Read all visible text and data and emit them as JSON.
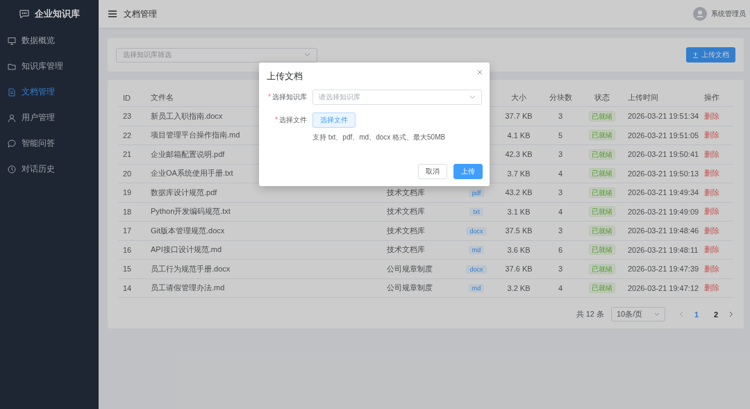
{
  "sidebar": {
    "logo": "企业知识库",
    "items": [
      {
        "label": "数据概览",
        "selected": false
      },
      {
        "label": "知识库管理",
        "selected": false
      },
      {
        "label": "文档管理",
        "selected": true
      },
      {
        "label": "用户管理",
        "selected": false
      },
      {
        "label": "智能问答",
        "selected": false
      },
      {
        "label": "对话历史",
        "selected": false
      }
    ]
  },
  "header": {
    "title": "文档管理",
    "user": "系统管理员"
  },
  "filter": {
    "placeholder": "选择知识库筛选",
    "upload_button": "上传文档"
  },
  "table": {
    "columns": [
      "ID",
      "文件名",
      null,
      null,
      "大小",
      "分块数",
      "状态",
      "上传时间",
      "操作"
    ],
    "rows": [
      {
        "id": "23",
        "name": "新员工入职指南.docx",
        "size": "37.7 KB",
        "chunks": "3",
        "status": "已就绪",
        "time": "2026-03-21 19:51:34",
        "action": "删除"
      },
      {
        "id": "22",
        "name": "项目管理平台操作指南.md",
        "size": "4.1 KB",
        "chunks": "5",
        "status": "已就绪",
        "time": "2026-03-21 19:51:05",
        "action": "删除"
      },
      {
        "id": "21",
        "name": "企业邮箱配置说明.pdf",
        "size": "42.3 KB",
        "chunks": "3",
        "status": "已就绪",
        "time": "2026-03-21 19:50:41",
        "action": "删除"
      },
      {
        "id": "20",
        "name": "企业OA系统使用手册.txt",
        "size": "3.7 KB",
        "chunks": "4",
        "status": "已就绪",
        "time": "2026-03-21 19:50:13",
        "action": "删除"
      },
      {
        "id": "19",
        "name": "数据库设计规范.pdf",
        "library": "技术文档库",
        "type": "pdf",
        "size": "43.2 KB",
        "chunks": "3",
        "status": "已就绪",
        "time": "2026-03-21 19:49:34",
        "action": "删除"
      },
      {
        "id": "18",
        "name": "Python开发编码规范.txt",
        "library": "技术文档库",
        "type": "txt",
        "size": "3.1 KB",
        "chunks": "4",
        "status": "已就绪",
        "time": "2026-03-21 19:49:09",
        "action": "删除"
      },
      {
        "id": "17",
        "name": "Git版本管理规范.docx",
        "library": "技术文档库",
        "type": "docx",
        "size": "37.5 KB",
        "chunks": "3",
        "status": "已就绪",
        "time": "2026-03-21 19:48:46",
        "action": "删除"
      },
      {
        "id": "16",
        "name": "API接口设计规范.md",
        "library": "技术文档库",
        "type": "md",
        "size": "3.6 KB",
        "chunks": "6",
        "status": "已就绪",
        "time": "2026-03-21 19:48:11",
        "action": "删除"
      },
      {
        "id": "15",
        "name": "员工行为规范手册.docx",
        "library": "公司规章制度",
        "type": "docx",
        "size": "37.6 KB",
        "chunks": "3",
        "status": "已就绪",
        "time": "2026-03-21 19:47:39",
        "action": "删除"
      },
      {
        "id": "14",
        "name": "员工请假管理办法.md",
        "library": "公司规章制度",
        "type": "md",
        "size": "3.2 KB",
        "chunks": "4",
        "status": "已就绪",
        "time": "2026-03-21 19:47:12",
        "action": "删除"
      }
    ]
  },
  "pagination": {
    "total": "共 12 条",
    "page_size": "10条/页",
    "pages": [
      {
        "label": "1",
        "selected": true
      },
      {
        "label": "2",
        "selected": false
      }
    ]
  },
  "dialog": {
    "title": "上传文档",
    "fields": [
      {
        "kind": "select",
        "mark": "*",
        "label": "选择知识库",
        "placeholder": "请选择知识库"
      },
      {
        "kind": "file",
        "mark": "*",
        "label": "选择文件",
        "button": "选择文件",
        "hint": "支持 txt、pdf、md、docx 格式、最大50MB"
      }
    ],
    "buttons": [
      {
        "kind": "default",
        "label": "取消"
      },
      {
        "kind": "primary",
        "label": "上传"
      }
    ]
  }
}
